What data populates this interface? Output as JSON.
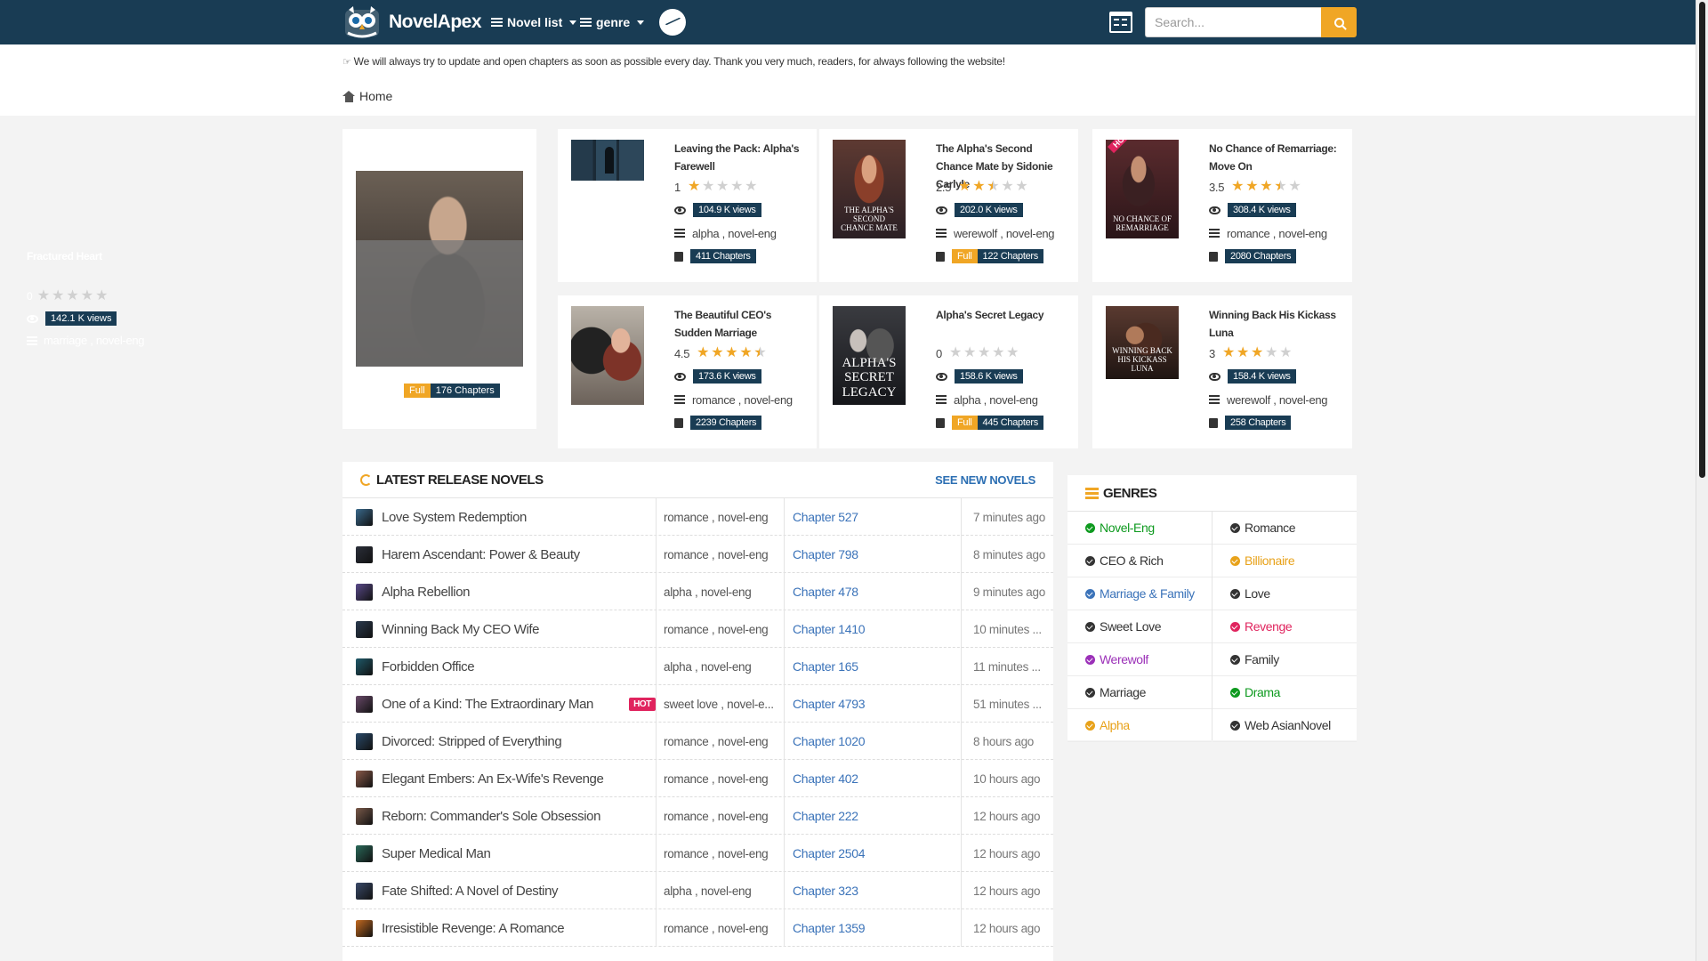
{
  "header": {
    "brand": "NovelApex",
    "nav_novel_list": "Novel list",
    "nav_genre": "genre",
    "search_placeholder": "Search..."
  },
  "announcement": "We will always try to update and open chapters as soon as possible every day. Thank you very much, readers, for always following the website!",
  "breadcrumb": {
    "home": "Home"
  },
  "featured": {
    "title": "Fractured Heart",
    "rating": "0",
    "rating_value": 0,
    "views": "142.1 K views",
    "genres": "marriage , novel-eng",
    "status": "Full",
    "chapters": "176 Chapters"
  },
  "cards": [
    {
      "title": "Leaving the Pack: Alpha's Farewell",
      "rating": "1",
      "rating_value": 1,
      "views": "104.9 K views",
      "genres": "alpha , novel-eng",
      "full": "",
      "chapters": "411 Chapters",
      "hot": false
    },
    {
      "title": "The Alpha's Second Chance Mate by Sidonie Carlyle",
      "rating": "2.5",
      "rating_value": 2.5,
      "views": "202.0 K views",
      "genres": "werewolf , novel-eng",
      "full": "Full",
      "chapters": "122 Chapters",
      "hot": false
    },
    {
      "title": "No Chance of Remarriage: Move On",
      "rating": "3.5",
      "rating_value": 3.5,
      "views": "308.4 K views",
      "genres": "romance , novel-eng",
      "full": "",
      "chapters": "2080 Chapters",
      "hot": true
    },
    {
      "title": "The Beautiful CEO's Sudden Marriage",
      "rating": "4.5",
      "rating_value": 4.5,
      "views": "173.6 K views",
      "genres": "romance , novel-eng",
      "full": "",
      "chapters": "2239 Chapters",
      "hot": false
    },
    {
      "title": "Alpha's Secret Legacy",
      "rating": "0",
      "rating_value": 0,
      "views": "158.6 K views",
      "genres": "alpha , novel-eng",
      "full": "Full",
      "chapters": "445 Chapters",
      "hot": false
    },
    {
      "title": "Winning Back His Kickass Luna",
      "rating": "3",
      "rating_value": 3,
      "views": "158.4 K views",
      "genres": "werewolf , novel-eng",
      "full": "",
      "chapters": "258 Chapters",
      "hot": false
    }
  ],
  "cover_texts": {
    "hot_ribbon": "HOT",
    "second_chance": "THE ALPHA'S SECOND CHANCE MATE",
    "remarriage": "NO CHANCE OF REMARRIAGE",
    "secret_legacy": "ALPHA'S SECRET LEGACY",
    "kickass_luna": "WINNING BACK HIS KICKASS LUNA"
  },
  "latest": {
    "title": "LATEST RELEASE NOVELS",
    "see_new": "SEE NEW NOVELS",
    "hot_label": "HOT",
    "rows": [
      {
        "name": "Love System Redemption",
        "genres": "romance , novel-eng",
        "chapter": "Chapter 527",
        "time": "7 minutes ago",
        "hot": false
      },
      {
        "name": "Harem Ascendant: Power & Beauty",
        "genres": "romance , novel-eng",
        "chapter": "Chapter 798",
        "time": "8 minutes ago",
        "hot": false
      },
      {
        "name": "Alpha Rebellion",
        "genres": "alpha , novel-eng",
        "chapter": "Chapter 478",
        "time": "9 minutes ago",
        "hot": false
      },
      {
        "name": "Winning Back My CEO Wife",
        "genres": "romance , novel-eng",
        "chapter": "Chapter 1410",
        "time": "10 minutes ...",
        "hot": false
      },
      {
        "name": "Forbidden Office",
        "genres": "alpha , novel-eng",
        "chapter": "Chapter 165",
        "time": "11 minutes ...",
        "hot": false
      },
      {
        "name": "One of a Kind: The Extraordinary Man",
        "genres": "sweet love , novel-e...",
        "chapter": "Chapter 4793",
        "time": "51 minutes ...",
        "hot": true
      },
      {
        "name": "Divorced: Stripped of Everything",
        "genres": "romance , novel-eng",
        "chapter": "Chapter 1020",
        "time": "8 hours ago",
        "hot": false
      },
      {
        "name": "Elegant Embers: An Ex-Wife's Revenge",
        "genres": "romance , novel-eng",
        "chapter": "Chapter 402",
        "time": "10 hours ago",
        "hot": false
      },
      {
        "name": "Reborn: Commander's Sole Obsession",
        "genres": "romance , novel-eng",
        "chapter": "Chapter 222",
        "time": "12 hours ago",
        "hot": false
      },
      {
        "name": "Super Medical Man",
        "genres": "romance , novel-eng",
        "chapter": "Chapter 2504",
        "time": "12 hours ago",
        "hot": false
      },
      {
        "name": "Fate Shifted: A Novel of Destiny",
        "genres": "alpha , novel-eng",
        "chapter": "Chapter 323",
        "time": "12 hours ago",
        "hot": false
      },
      {
        "name": "Irresistible Revenge: A Romance",
        "genres": "romance , novel-eng",
        "chapter": "Chapter 1359",
        "time": "12 hours ago",
        "hot": false
      }
    ]
  },
  "genres": {
    "title": "GENRES",
    "items": [
      {
        "label": "Novel-Eng",
        "color": "#0e9a1f"
      },
      {
        "label": "Romance",
        "color": "#333333"
      },
      {
        "label": "CEO & Rich",
        "color": "#333333"
      },
      {
        "label": "Billionaire",
        "color": "#e8a21a"
      },
      {
        "label": "Marriage & Family",
        "color": "#3b73b9"
      },
      {
        "label": "Love",
        "color": "#333333"
      },
      {
        "label": "Sweet Love",
        "color": "#333333"
      },
      {
        "label": "Revenge",
        "color": "#e0245e"
      },
      {
        "label": "Werewolf",
        "color": "#9b30b8"
      },
      {
        "label": "Family",
        "color": "#333333"
      },
      {
        "label": "Marriage",
        "color": "#333333"
      },
      {
        "label": "Drama",
        "color": "#0e9a1f"
      },
      {
        "label": "Alpha",
        "color": "#e8a21a"
      },
      {
        "label": "Web AsianNovel",
        "color": "#333333"
      }
    ]
  },
  "colors": {
    "header_bg": "#193c54",
    "accent": "#f0a625",
    "link": "#3b73b9",
    "hot": "#e0245e"
  }
}
